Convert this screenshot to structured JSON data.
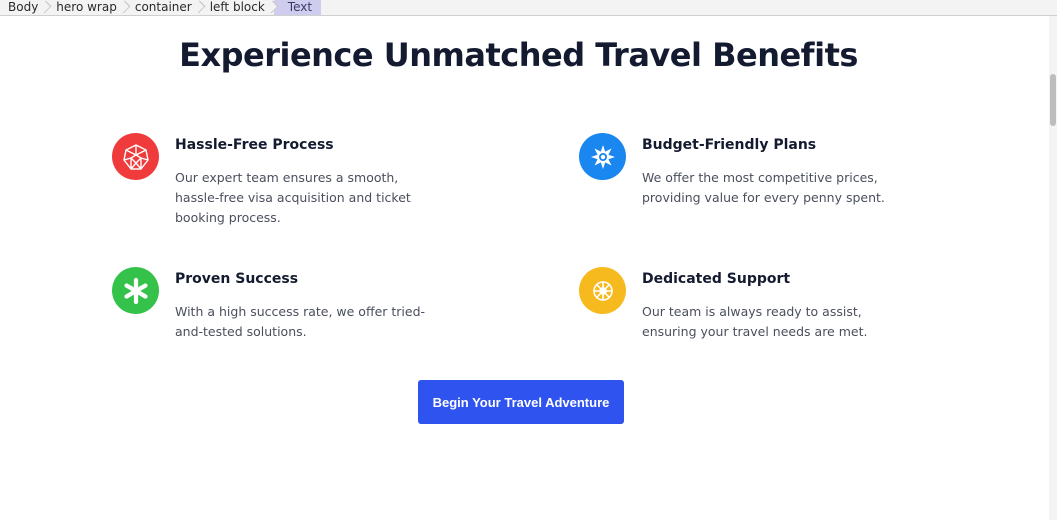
{
  "breadcrumb": {
    "items": [
      {
        "label": "Body"
      },
      {
        "label": "hero wrap"
      },
      {
        "label": "container"
      },
      {
        "label": "left block"
      },
      {
        "label": "Text"
      }
    ]
  },
  "page": {
    "title": "Experience Unmatched Travel Benefits"
  },
  "features": [
    {
      "title": "Hassle-Free Process",
      "description": "Our expert team ensures a smooth, hassle-free visa acquisition and ticket booking process.",
      "icon": "geodesic-icon",
      "color": "#ef3b3b"
    },
    {
      "title": "Budget-Friendly Plans",
      "description": "We offer the most competitive prices, providing value for every penny spent.",
      "icon": "starburst-icon",
      "color": "#1a86f0"
    },
    {
      "title": "Proven Success",
      "description": "With a high success rate, we offer tried-and-tested solutions.",
      "icon": "asterisk-icon",
      "color": "#35c24a"
    },
    {
      "title": "Dedicated Support",
      "description": "Our team is always ready to assist, ensuring your travel needs are met.",
      "icon": "snowflake-icon",
      "color": "#f6b91e"
    }
  ],
  "cta": {
    "label": "Begin Your Travel Adventure",
    "color": "#2f53ee"
  }
}
